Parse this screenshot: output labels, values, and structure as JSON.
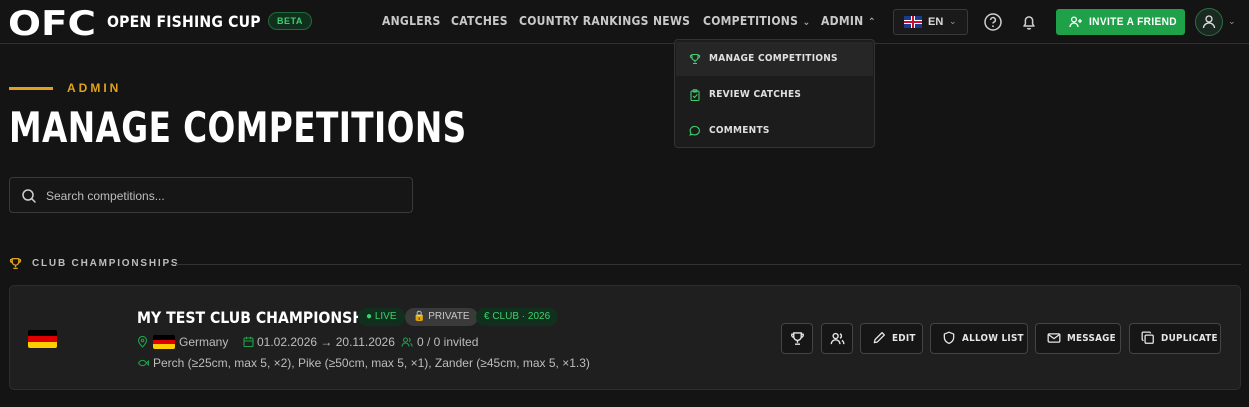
{
  "header": {
    "logo_text": "OFC",
    "brand": "OPEN FISHING CUP",
    "beta_badge": "BETA",
    "nav": [
      {
        "label": "ANGLERS"
      },
      {
        "label": "CATCHES"
      },
      {
        "label": "COUNTRY RANKINGS"
      },
      {
        "label": "NEWS"
      },
      {
        "label": "COMPETITIONS",
        "caret": "⌄"
      },
      {
        "label": "ADMIN",
        "caret": "⌃"
      }
    ],
    "language": {
      "code": "EN",
      "flag": "uk-flag",
      "caret": "⌄"
    },
    "invite_label": "INVITE A FRIEND",
    "avatar_caret": "⌄"
  },
  "admin_menu": {
    "items": [
      {
        "label": "MANAGE COMPETITIONS",
        "icon": "trophy-icon",
        "active": true
      },
      {
        "label": "REVIEW CATCHES",
        "icon": "clipboard-check-icon",
        "active": false
      },
      {
        "label": "COMMENTS",
        "icon": "chat-bubble-icon",
        "active": false
      }
    ]
  },
  "page": {
    "eyebrow": "ADMIN",
    "title": "MANAGE COMPETITIONS",
    "search_placeholder": "Search competitions..."
  },
  "section": {
    "label": "CLUB CHAMPIONSHIPS",
    "icon": "trophy-icon"
  },
  "competition": {
    "title": "MY TEST CLUB CHAMPIONSHIP",
    "status_badge": "● LIVE",
    "visibility_badge": "🔒 PRIVATE",
    "type_badge": "€ CLUB · 2026",
    "country": "Germany",
    "date_range": "01.02.2026 → 20.11.2026",
    "invited": "0 / 0 invited",
    "species_rules": "Perch (≥25cm, max 5, ×2), Pike (≥50cm, max 5, ×1), Zander (≥45cm, max 5, ×1.3)",
    "actions": {
      "edit": "EDIT",
      "allow_list": "ALLOW LIST",
      "message": "MESSAGE",
      "duplicate": "DUPLICATE"
    }
  },
  "colors": {
    "background": "#141414",
    "accent_green": "#1fa14a",
    "accent_gold": "#e0a21a",
    "badge_green_text": "#3ecf6e",
    "card": "#1f1f1f"
  }
}
